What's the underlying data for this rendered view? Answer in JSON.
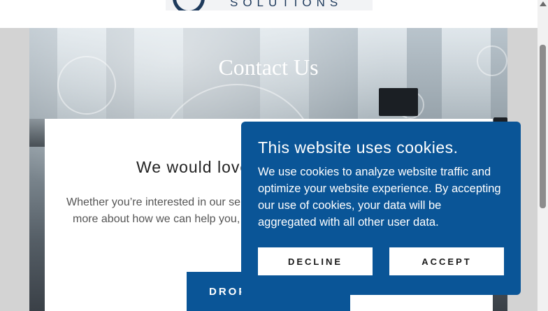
{
  "header": {
    "logo_text": "SOLUTIONS"
  },
  "hero": {
    "title": "Contact Us"
  },
  "card": {
    "heading": "We would love to hear from you",
    "text_line1": "Whether you’re interested in our services or want to learn",
    "text_line2": "more about how we can help you, reach out to us.",
    "button_label": "DROP US A NOTE"
  },
  "cookie_banner": {
    "title": "This website uses cookies.",
    "body": "We use cookies to analyze website traffic and optimize your website experience. By accepting our use of cookies, your data will be aggregated with all other user data.",
    "decline_label": "DECLINE",
    "accept_label": "ACCEPT"
  }
}
